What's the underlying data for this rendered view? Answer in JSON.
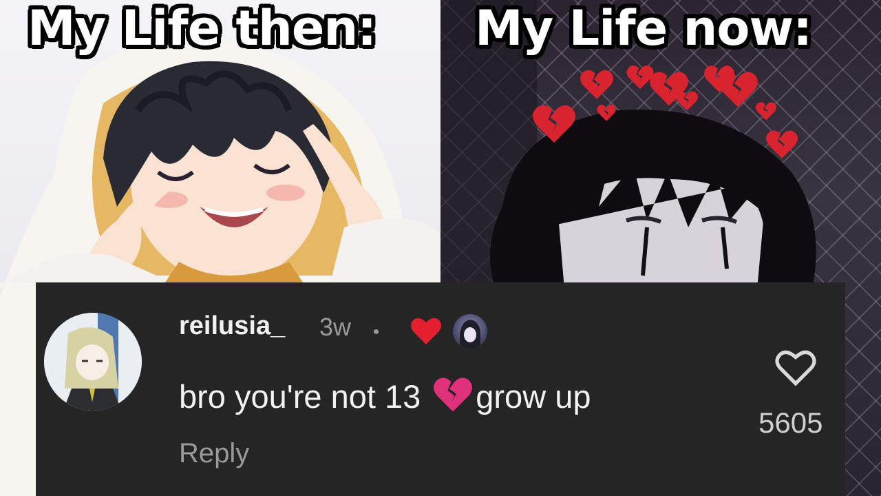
{
  "meme": {
    "left_caption": "My Life then:",
    "right_caption": "My Life now:"
  },
  "comment": {
    "username": "reilusia_",
    "time_ago": "3w",
    "text_before_emoji": "bro you're not 13",
    "text_after_emoji": "grow up",
    "reply_label": "Reply",
    "like_count": "5605"
  },
  "icons": {
    "creator_heart": "red-heart-icon",
    "like": "heart-outline-icon",
    "emoji": "broken-heart-icon"
  },
  "colors": {
    "card_background": "#252526",
    "creator_heart": "#e5202e",
    "broken_heart": "#e0327a"
  }
}
